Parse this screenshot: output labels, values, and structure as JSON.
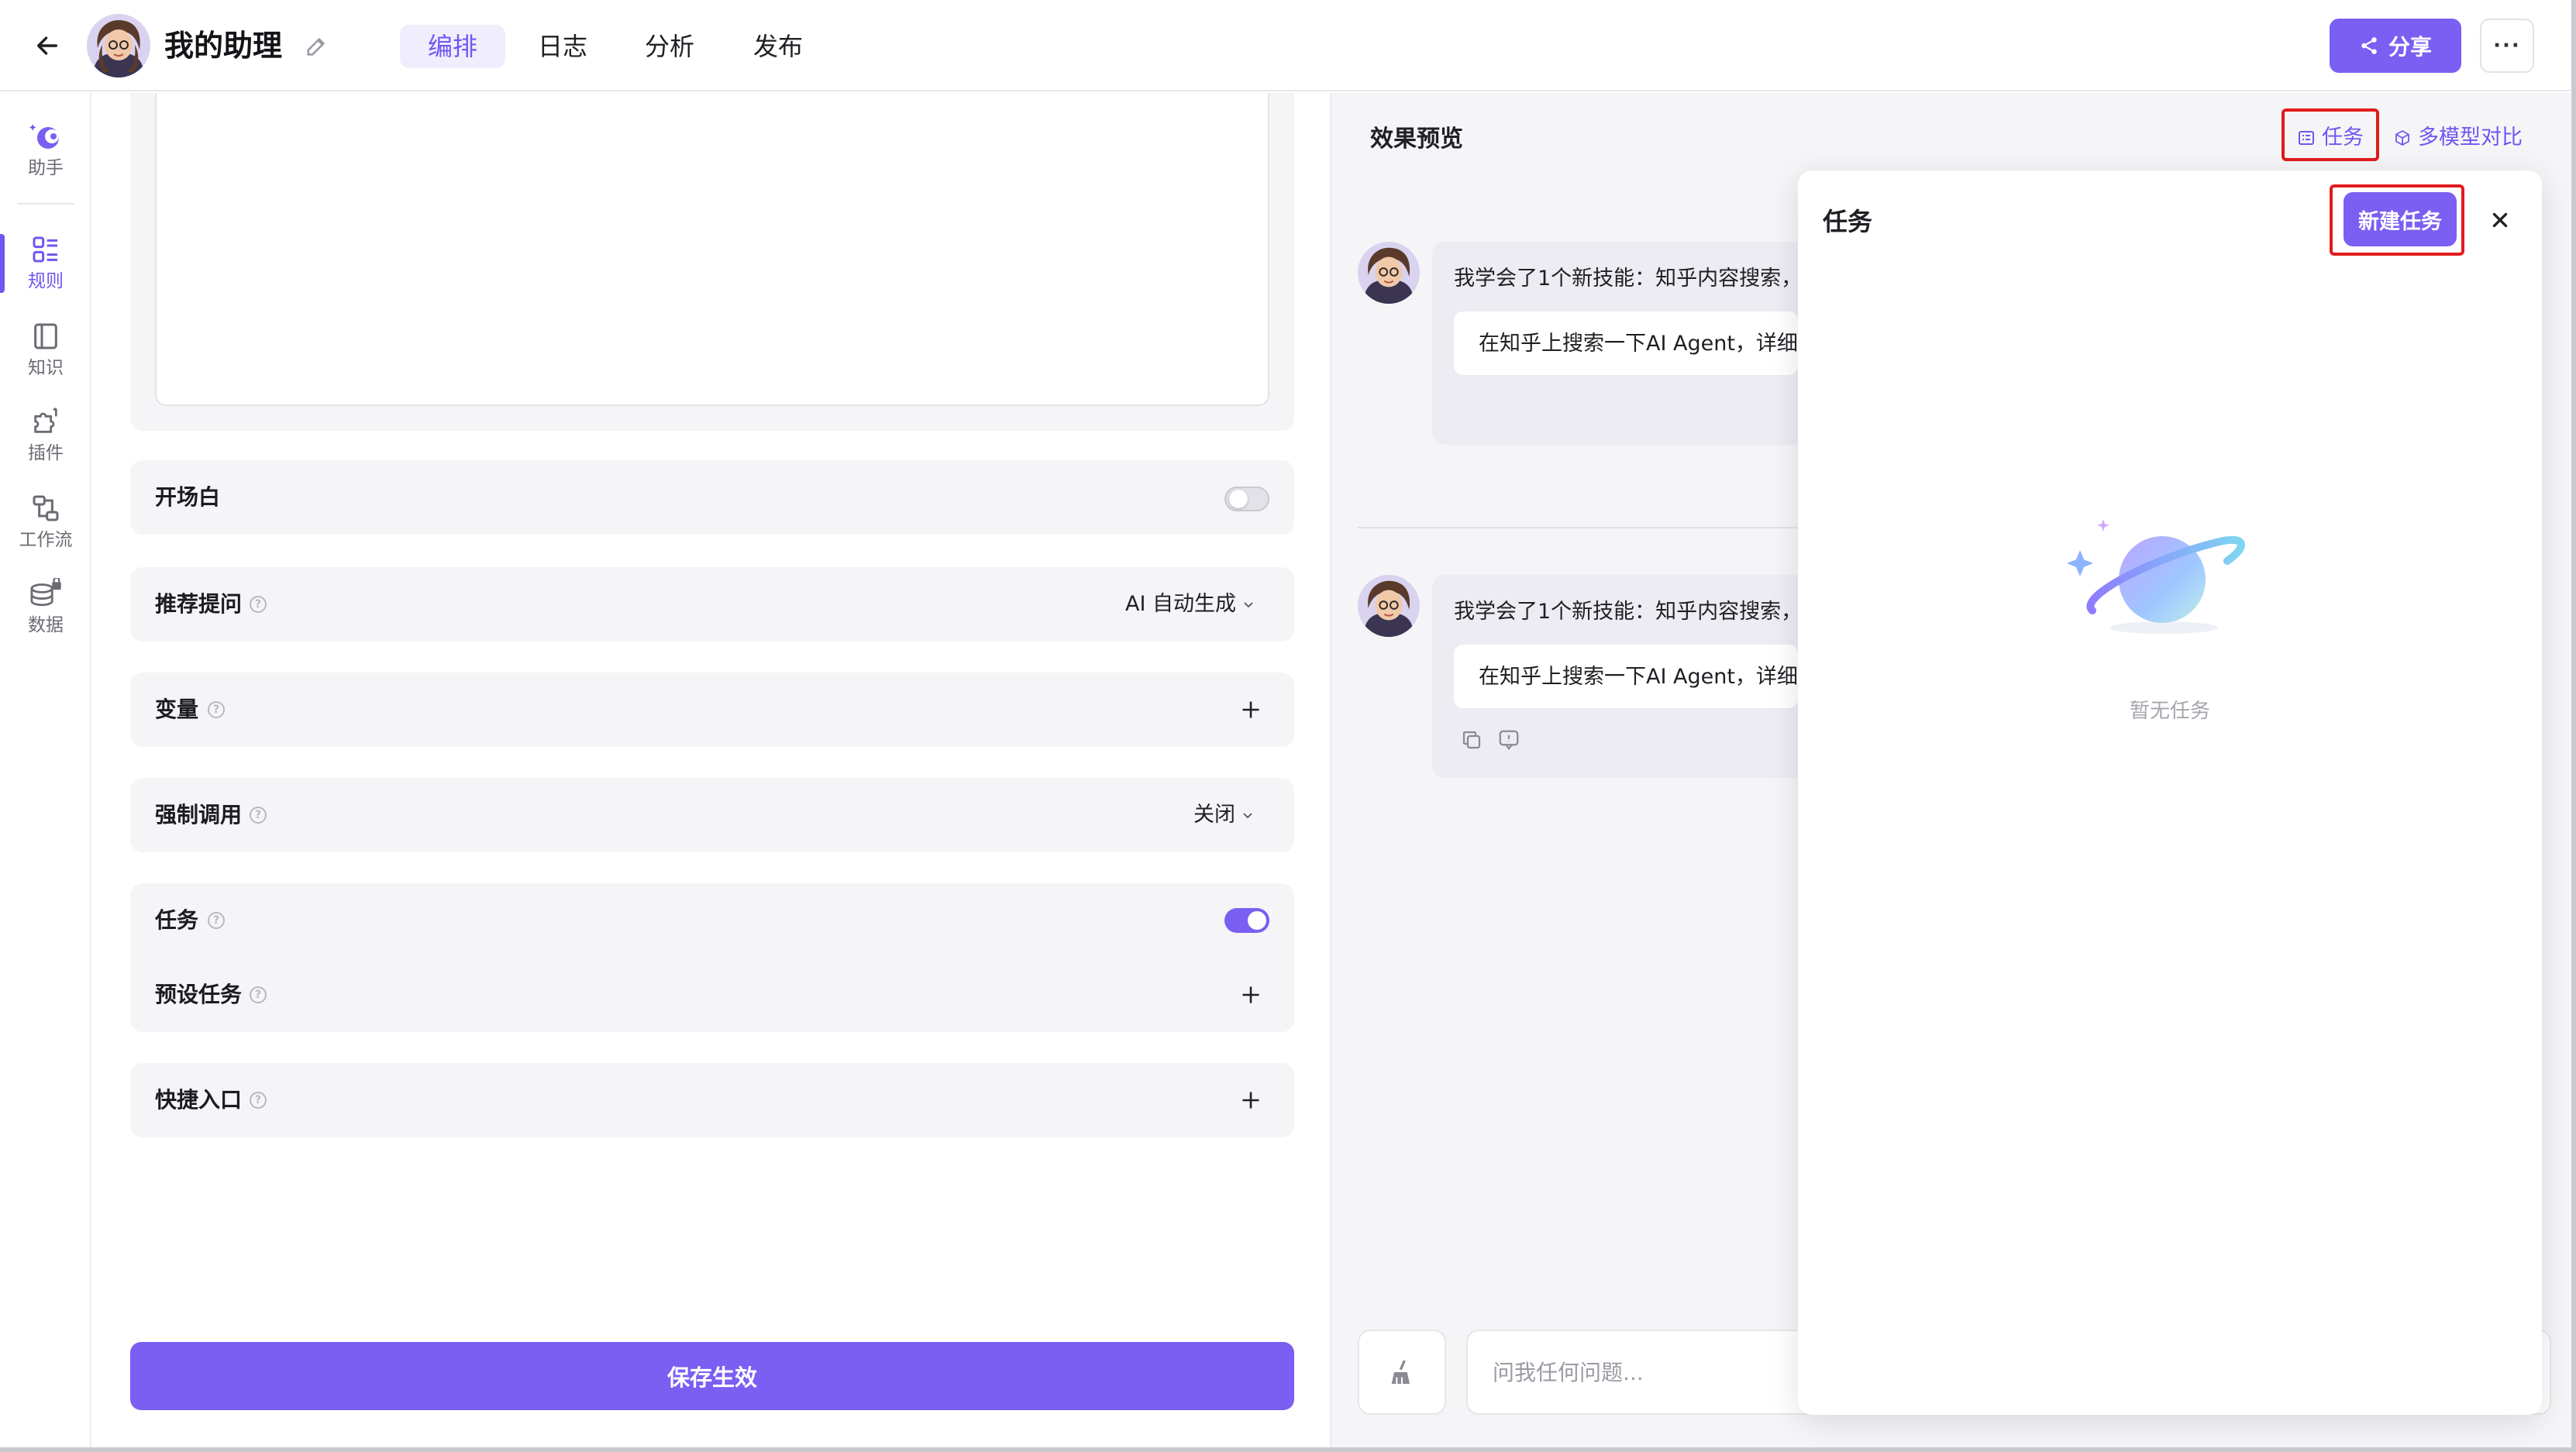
{
  "header": {
    "title": "我的助理",
    "tabs": [
      {
        "label": "编排",
        "active": true
      },
      {
        "label": "日志",
        "active": false
      },
      {
        "label": "分析",
        "active": false
      },
      {
        "label": "发布",
        "active": false
      }
    ],
    "share_label": "分享",
    "more_label": "···"
  },
  "sidebar": {
    "items": [
      {
        "label": "助手",
        "icon": "assistant-icon"
      },
      {
        "label": "规则",
        "icon": "rules-icon",
        "active": true
      },
      {
        "label": "知识",
        "icon": "knowledge-icon"
      },
      {
        "label": "插件",
        "icon": "plugin-icon"
      },
      {
        "label": "工作流",
        "icon": "workflow-icon"
      },
      {
        "label": "数据",
        "icon": "data-icon"
      }
    ]
  },
  "config": {
    "opening": {
      "label": "开场白",
      "enabled": false
    },
    "suggest": {
      "label": "推荐提问",
      "value": "AI 自动生成"
    },
    "variables": {
      "label": "变量"
    },
    "force_call": {
      "label": "强制调用",
      "value": "关闭"
    },
    "tasks": {
      "label": "任务",
      "enabled": true
    },
    "preset_tasks": {
      "label": "预设任务"
    },
    "shortcuts": {
      "label": "快捷入口"
    },
    "save_label": "保存生效"
  },
  "preview": {
    "title": "效果预览",
    "task_link": "任务",
    "compare_link": "多模型对比",
    "messages": [
      {
        "text": "我学会了1个新技能：知乎内容搜索，",
        "suggestion": "在知乎上搜索一下AI Agent，详细"
      },
      {
        "text": "我学会了1个新技能：知乎内容搜索，",
        "suggestion": "在知乎上搜索一下AI Agent，详细"
      }
    ],
    "input_placeholder": "问我任何问题..."
  },
  "task_drawer": {
    "title": "任务",
    "new_task_label": "新建任务",
    "empty_text": "暂无任务"
  },
  "colors": {
    "accent": "#7a5ff2",
    "highlight_box": "#e21b1b"
  }
}
